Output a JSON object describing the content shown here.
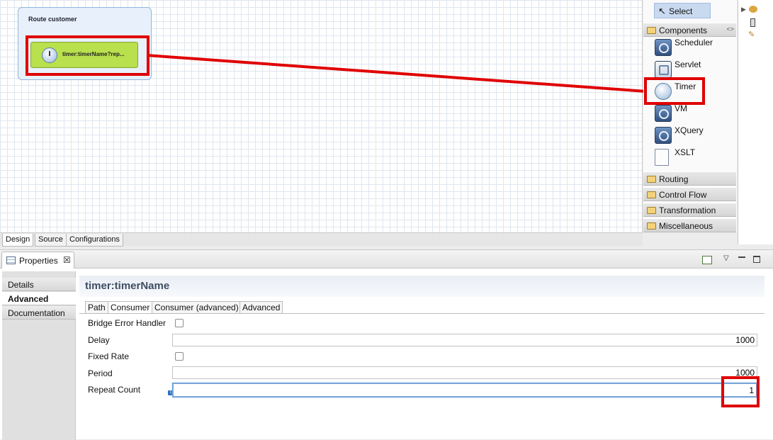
{
  "canvas": {
    "route_title": "Route customer",
    "node_label": "timer:timerName?rep..."
  },
  "editor_tabs": [
    "Design",
    "Source",
    "Configurations"
  ],
  "palette": {
    "select_label": "Select",
    "drawers": {
      "components": "Components",
      "routing": "Routing",
      "control_flow": "Control Flow",
      "transformation": "Transformation",
      "miscellaneous": "Miscellaneous"
    },
    "components": [
      "Scheduler",
      "Servlet",
      "Timer",
      "VM",
      "XQuery",
      "XSLT"
    ],
    "collapse_glyph": "<>"
  },
  "properties": {
    "view_title": "Properties",
    "close_glyph": "☒",
    "side_tabs": [
      "Details",
      "Advanced",
      "Documentation"
    ],
    "active_side_tab": "Advanced",
    "content_title": "timer:timerName",
    "content_tabs": [
      "Path",
      "Consumer",
      "Consumer (advanced)",
      "Advanced"
    ],
    "active_content_tab": "Consumer",
    "fields": {
      "bridge_error_handler": {
        "label": "Bridge Error Handler",
        "checked": false
      },
      "delay": {
        "label": "Delay",
        "value": "1000"
      },
      "fixed_rate": {
        "label": "Fixed Rate",
        "checked": false
      },
      "period": {
        "label": "Period",
        "value": "1000"
      },
      "repeat_count": {
        "label": "Repeat Count",
        "value": "1"
      }
    }
  },
  "colors": {
    "highlight": "#e00000",
    "node_fill": "#b9e04d",
    "route_fill": "#e8f1fb",
    "select_fill": "#c9d9f0"
  }
}
